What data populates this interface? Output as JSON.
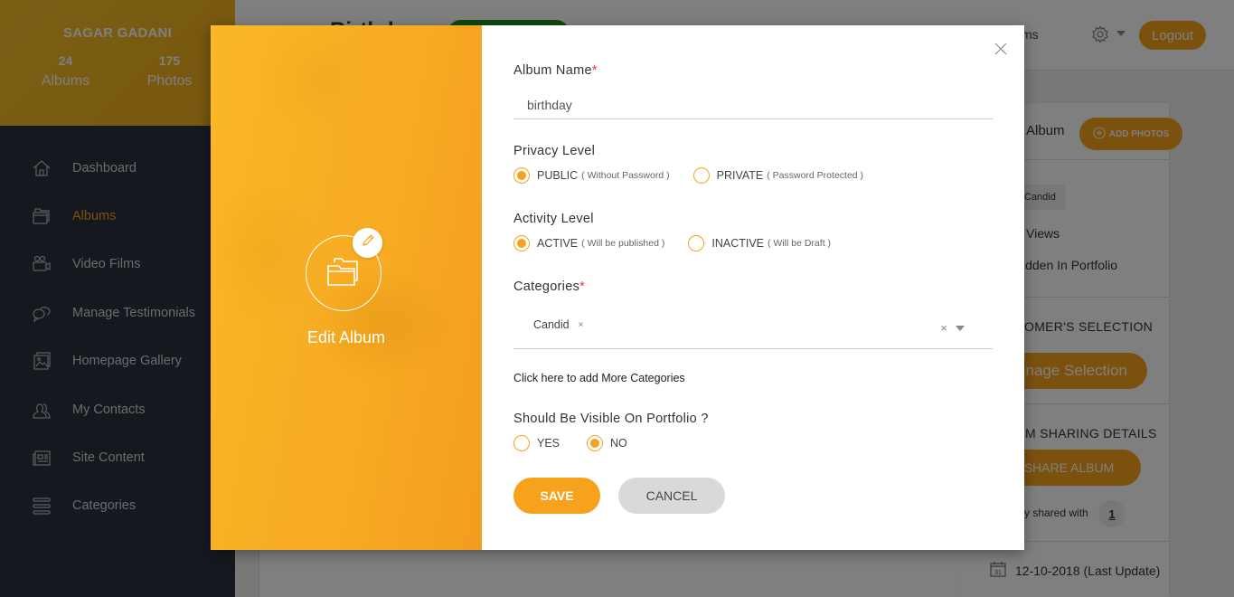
{
  "sidebar": {
    "profile": {
      "name": "SAGAR GADANI",
      "stats": [
        {
          "value": "24",
          "label": "Albums"
        },
        {
          "value": "175",
          "label": "Photos"
        }
      ]
    },
    "items": [
      {
        "label": "Dashboard",
        "icon": "home-icon",
        "active": false
      },
      {
        "label": "Albums",
        "icon": "folder-icon",
        "active": true
      },
      {
        "label": "Video Films",
        "icon": "video-camera-icon",
        "active": false
      },
      {
        "label": "Manage Testimonials",
        "icon": "chat-bubbles-icon",
        "active": false
      },
      {
        "label": "Homepage Gallery",
        "icon": "gallery-icon",
        "active": false
      },
      {
        "label": "My Contacts",
        "icon": "users-icon",
        "active": false
      },
      {
        "label": "Site Content",
        "icon": "newspaper-icon",
        "active": false
      },
      {
        "label": "Categories",
        "icon": "list-icon",
        "active": false
      }
    ]
  },
  "topbar": {
    "title": "Birthday",
    "link_partial": "ms",
    "logout_label": "Logout"
  },
  "right_card": {
    "album_label": "Album",
    "add_photos_label": "ADD PHOTOS",
    "tag": "Candid",
    "views": "Views",
    "hidden": "idden In Portfolio",
    "customer_selection_heading": "OMER'S SELECTION",
    "manage_selection_label": "anage Selection",
    "sharing_heading": "M SHARING DETAILS",
    "share_album_label": "SHARE ALBUM",
    "shared_with_text": "y shared with",
    "shared_count": "1",
    "last_update": "12-10-2018 (Last Update)",
    "calendar_day": "31"
  },
  "modal": {
    "title": "Edit Album",
    "fields": {
      "album_name": {
        "label": "Album Name",
        "required": "*",
        "value": "birthday"
      },
      "privacy": {
        "label": "Privacy Level",
        "options": [
          {
            "main": "PUBLIC",
            "hint": "( Without Password )",
            "selected": true
          },
          {
            "main": "PRIVATE",
            "hint": "( Password Protected )",
            "selected": false
          }
        ]
      },
      "activity": {
        "label": "Activity Level",
        "options": [
          {
            "main": "ACTIVE",
            "hint": "( Will be published )",
            "selected": true
          },
          {
            "main": "INACTIVE",
            "hint": "( Will be Draft )",
            "selected": false
          }
        ]
      },
      "categories": {
        "label": "Categories",
        "required": "*",
        "selected": [
          "Candid"
        ],
        "chip_remove": "×",
        "clear_all": "×"
      },
      "add_categories_link": "Click here to add More Categories",
      "portfolio": {
        "label": "Should Be Visible On Portfolio ?",
        "options": [
          {
            "main": "YES",
            "selected": false
          },
          {
            "main": "NO",
            "selected": true
          }
        ]
      }
    },
    "save_label": "SAVE",
    "cancel_label": "CANCEL"
  },
  "colors": {
    "accent": "#f7a21d",
    "sidebar_bg": "#2b313c",
    "required": "#e8393b"
  }
}
